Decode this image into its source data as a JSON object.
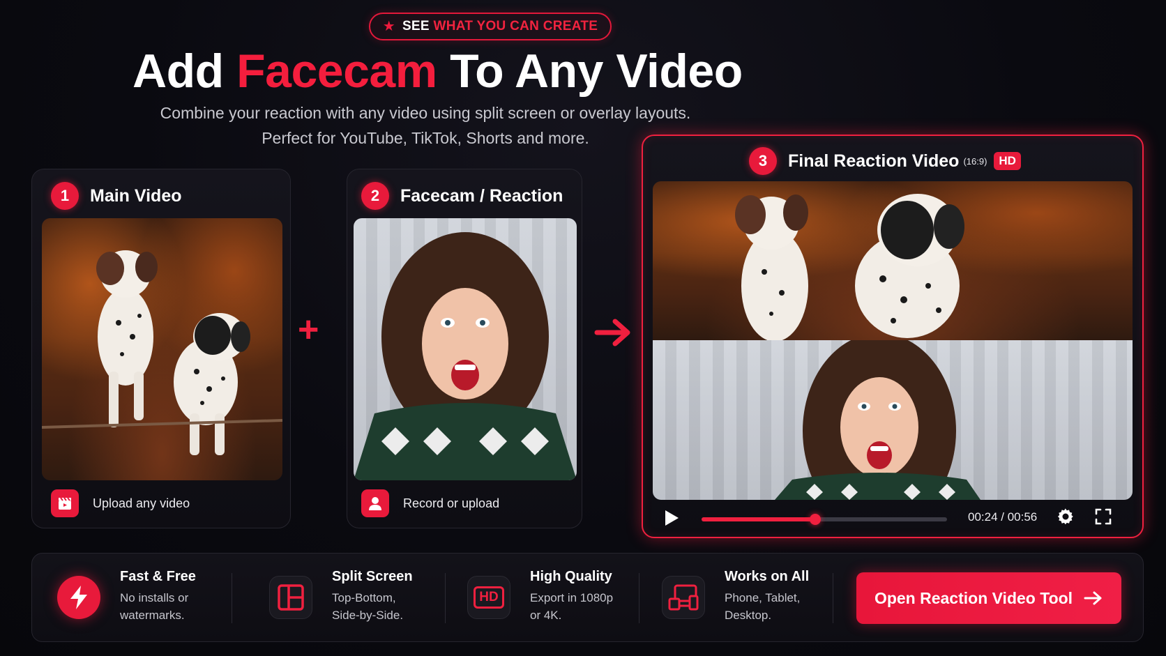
{
  "badge": {
    "part_white": "SEE",
    "part_red": "WHAT YOU CAN CREATE",
    "icon": "star-icon"
  },
  "headline": {
    "before": "Add",
    "accent": "Facecam",
    "after": "To Any Video"
  },
  "subheadline": {
    "line1": "Combine your reaction with any video using split screen or overlay layouts.",
    "line2": "Perfect for YouTube, TikTok, Shorts and more."
  },
  "steps": [
    {
      "number": "1",
      "title": "Main Video",
      "footer": "Upload any video",
      "footer_icon": "clapperboard-icon"
    },
    {
      "number": "2",
      "title": "Facecam / Reaction",
      "footer": "Record or upload",
      "footer_icon": "user-icon"
    },
    {
      "number": "3",
      "title": "Final Reaction Video",
      "ratio": "(16:9)",
      "tag": "HD"
    }
  ],
  "connectors": {
    "plus": "+",
    "arrow_icon": "arrow-right-icon"
  },
  "player": {
    "time_current": "00:24",
    "time_total": "00:56",
    "time_display": "00:24 / 00:56",
    "progress": 0.4643,
    "icons": [
      "play-icon",
      "gear-icon",
      "fullscreen-icon"
    ]
  },
  "features": [
    {
      "title": "Fast & Free",
      "desc1": "No installs or",
      "desc2": "watermarks.",
      "icon": "lightning-icon"
    },
    {
      "title": "Split Screen",
      "desc1": "Top-Bottom,",
      "desc2": "Side-by-Side.",
      "icon": "layout-icon"
    },
    {
      "title": "High Quality",
      "desc1": "Export in 1080p",
      "desc2": "or 4K.",
      "icon": "hd-icon",
      "icon_text": "HD"
    },
    {
      "title": "Works on All",
      "desc1": "Phone, Tablet,",
      "desc2": "Desktop.",
      "icon": "devices-icon"
    }
  ],
  "cta": {
    "label": "Open Reaction Video Tool",
    "icon": "arrow-right-icon"
  },
  "colors": {
    "accent": "#f0203f",
    "background": "#08080d",
    "card": "#15141c"
  }
}
